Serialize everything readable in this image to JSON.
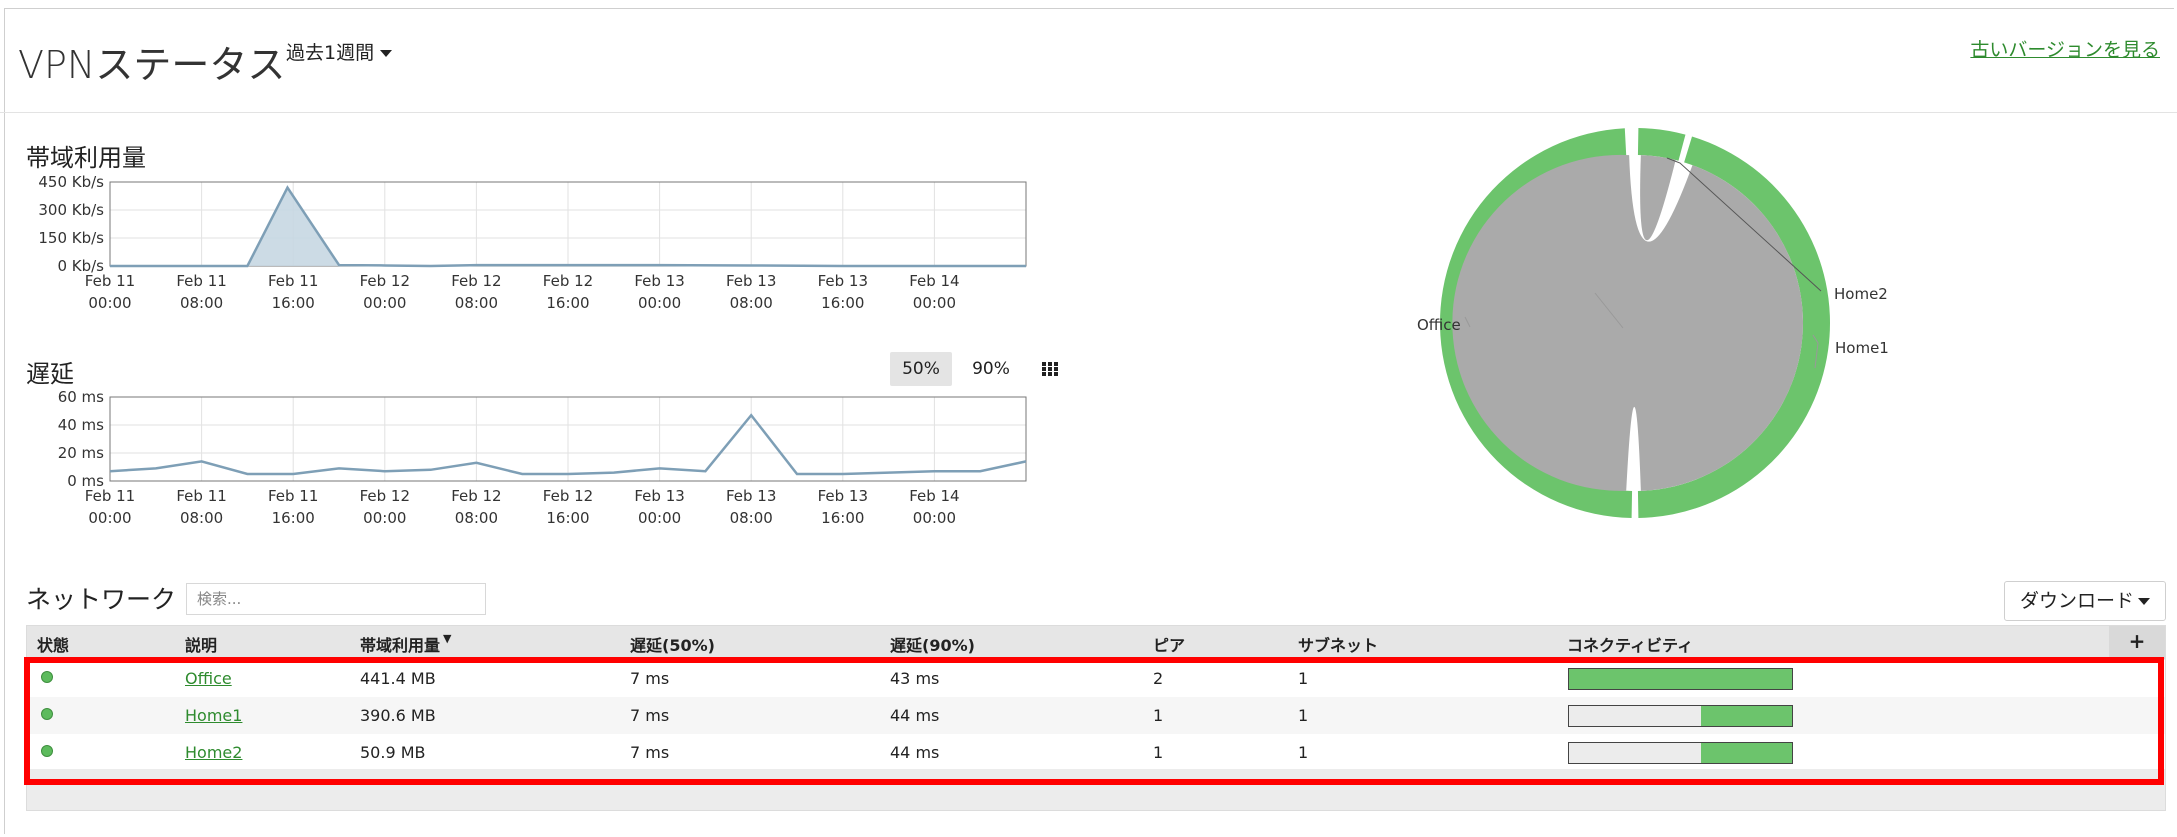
{
  "header": {
    "title": "VPNステータス",
    "period": "過去1週間",
    "old_version_link": "古いバージョンを見る"
  },
  "bandwidth": {
    "title": "帯域利用量",
    "y_ticks": [
      "450 Kb/s",
      "300 Kb/s",
      "150 Kb/s",
      "0 Kb/s"
    ],
    "x_ticks": [
      [
        "Feb 11",
        "00:00"
      ],
      [
        "Feb 11",
        "08:00"
      ],
      [
        "Feb 11",
        "16:00"
      ],
      [
        "Feb 12",
        "00:00"
      ],
      [
        "Feb 12",
        "08:00"
      ],
      [
        "Feb 12",
        "16:00"
      ],
      [
        "Feb 13",
        "00:00"
      ],
      [
        "Feb 13",
        "08:00"
      ],
      [
        "Feb 13",
        "16:00"
      ],
      [
        "Feb 14",
        "00:00"
      ]
    ]
  },
  "latency": {
    "title": "遅延",
    "toggle_50": "50%",
    "toggle_90": "90%",
    "y_ticks": [
      "60 ms",
      "40 ms",
      "20 ms",
      "0 ms"
    ],
    "x_ticks": [
      [
        "Feb 11",
        "00:00"
      ],
      [
        "Feb 11",
        "08:00"
      ],
      [
        "Feb 11",
        "16:00"
      ],
      [
        "Feb 12",
        "00:00"
      ],
      [
        "Feb 12",
        "08:00"
      ],
      [
        "Feb 12",
        "16:00"
      ],
      [
        "Feb 13",
        "00:00"
      ],
      [
        "Feb 13",
        "08:00"
      ],
      [
        "Feb 13",
        "16:00"
      ],
      [
        "Feb 14",
        "00:00"
      ]
    ]
  },
  "chord": {
    "labels": [
      "Office",
      "Home2",
      "Home1"
    ],
    "color_outer": "#6cc46c",
    "color_inner": "#aaaaaa"
  },
  "network": {
    "title": "ネットワーク",
    "search_placeholder": "検索...",
    "download_label": "ダウンロード",
    "add_column": "+",
    "columns": {
      "status": "状態",
      "description": "説明",
      "bandwidth": "帯域利用量",
      "sort_arrow": "▼",
      "latency50": "遅延(50%)",
      "latency90": "遅延(90%)",
      "peers": "ピア",
      "subnet": "サブネット",
      "connectivity": "コネクティビティ"
    },
    "rows": [
      {
        "name": "Office",
        "bandwidth": "441.4 MB",
        "lat50": "7 ms",
        "lat90": "43 ms",
        "peers": "2",
        "subnets": "1",
        "connectivity": 1.0
      },
      {
        "name": "Home1",
        "bandwidth": "390.6 MB",
        "lat50": "7 ms",
        "lat90": "44 ms",
        "peers": "1",
        "subnets": "1",
        "connectivity": 0.41
      },
      {
        "name": "Home2",
        "bandwidth": "50.9 MB",
        "lat50": "7 ms",
        "lat90": "44 ms",
        "peers": "1",
        "subnets": "1",
        "connectivity": 0.41
      }
    ]
  },
  "chart_data": [
    {
      "type": "area",
      "title": "帯域利用量",
      "x": [
        "Feb 11 00:00",
        "Feb 11 04:00",
        "Feb 11 08:00",
        "Feb 11 12:00",
        "Feb 11 15:30",
        "Feb 11 20:00",
        "Feb 12 00:00",
        "Feb 12 04:00",
        "Feb 12 08:00",
        "Feb 12 16:00",
        "Feb 13 00:00",
        "Feb 13 08:00",
        "Feb 13 16:00",
        "Feb 14 00:00",
        "Feb 14 08:00"
      ],
      "values": [
        0,
        0,
        0,
        0,
        420,
        5,
        3,
        0,
        5,
        5,
        5,
        3,
        0,
        0,
        0
      ],
      "ylim": [
        0,
        450
      ],
      "y_unit": "Kb/s",
      "grid": true
    },
    {
      "type": "line",
      "title": "遅延",
      "x": [
        "Feb 11 00:00",
        "Feb 11 04:00",
        "Feb 11 08:00",
        "Feb 11 12:00",
        "Feb 11 16:00",
        "Feb 11 20:00",
        "Feb 12 00:00",
        "Feb 12 04:00",
        "Feb 12 08:00",
        "Feb 12 12:00",
        "Feb 12 16:00",
        "Feb 12 20:00",
        "Feb 13 00:00",
        "Feb 13 04:00",
        "Feb 13 08:00",
        "Feb 13 12:00",
        "Feb 13 16:00",
        "Feb 13 20:00",
        "Feb 14 00:00",
        "Feb 14 04:00",
        "Feb 14 08:00"
      ],
      "values": [
        7,
        9,
        14,
        5,
        5,
        9,
        7,
        8,
        13,
        5,
        5,
        6,
        9,
        7,
        47,
        5,
        5,
        6,
        7,
        7,
        14
      ],
      "ylim": [
        0,
        60
      ],
      "y_unit": "ms",
      "grid": true
    }
  ]
}
